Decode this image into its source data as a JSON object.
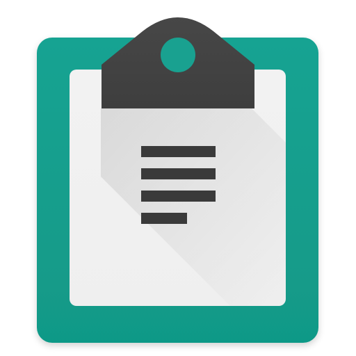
{
  "icon": {
    "name": "clipboard-icon",
    "colors": {
      "board": "#159f8e",
      "board_edge": "#0f8f80",
      "paper": "#f1f1f1",
      "paper_edge": "#e2e2e2",
      "clip": "#424242",
      "clip_hole": "#19a190",
      "text_lines": "#3a3a3a",
      "shadow": "#000000"
    },
    "line_count": 4
  }
}
